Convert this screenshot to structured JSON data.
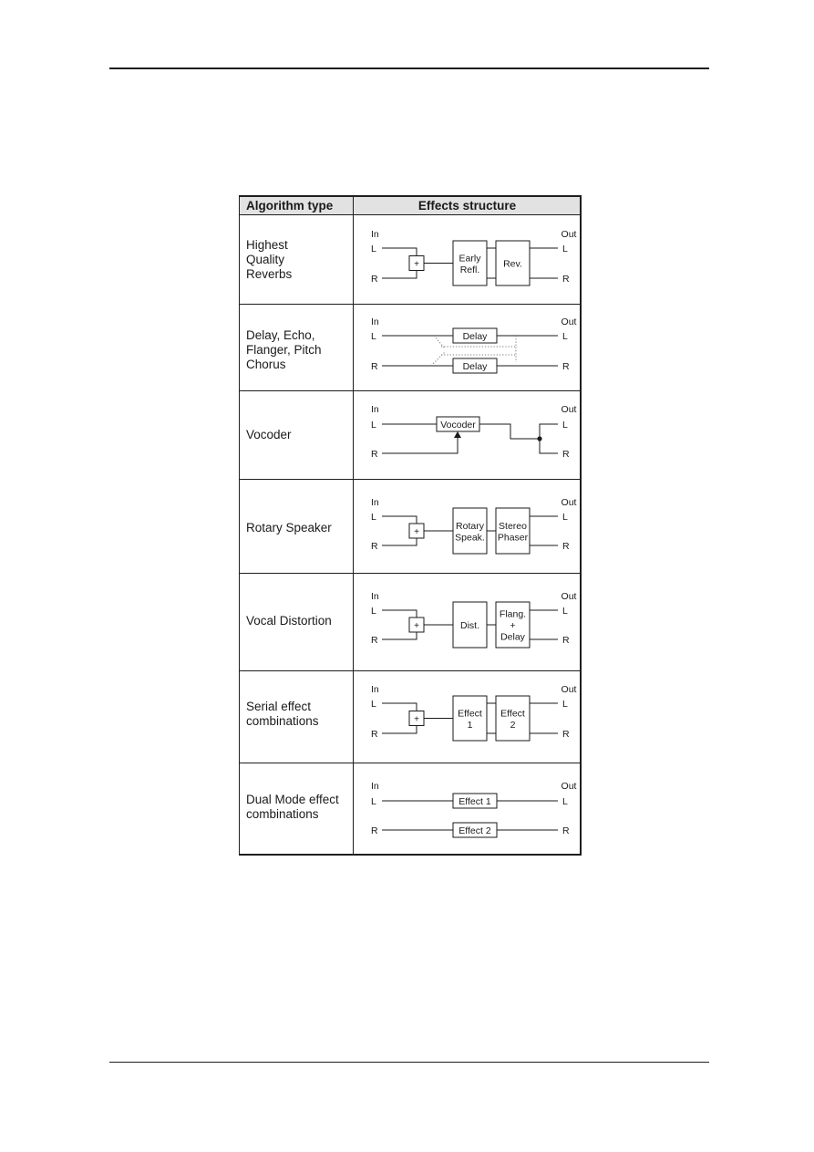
{
  "table": {
    "headers": {
      "algorithm_type": "Algorithm type",
      "effects_structure": "Effects structure"
    },
    "rows": [
      {
        "algorithm": "Highest\nQuality\nReverbs",
        "diagram": "reverb",
        "labels": {
          "in": "In",
          "out": "Out",
          "l": "L",
          "r": "R",
          "sum": "+",
          "block1": [
            "Early",
            "Refl."
          ],
          "block2": [
            "Rev."
          ]
        }
      },
      {
        "algorithm": "Delay, Echo,\nFlanger, Pitch\nChorus",
        "diagram": "delay",
        "labels": {
          "in": "In",
          "out": "Out",
          "l": "L",
          "r": "R",
          "block_l": "Delay",
          "block_r": "Delay"
        }
      },
      {
        "algorithm": "Vocoder",
        "diagram": "vocoder",
        "labels": {
          "in": "In",
          "out": "Out",
          "l": "L",
          "r": "R",
          "block": "Vocoder"
        }
      },
      {
        "algorithm": "Rotary Speaker",
        "diagram": "rotary",
        "labels": {
          "in": "In",
          "out": "Out",
          "l": "L",
          "r": "R",
          "sum": "+",
          "block1": [
            "Rotary",
            "Speak."
          ],
          "block2": [
            "Stereo",
            "Phaser"
          ]
        }
      },
      {
        "algorithm": "Vocal Distortion",
        "diagram": "distortion",
        "labels": {
          "in": "In",
          "out": "Out",
          "l": "L",
          "r": "R",
          "sum": "+",
          "block1": [
            "Dist."
          ],
          "block2": [
            "Flang.",
            "+",
            "Delay"
          ]
        }
      },
      {
        "algorithm": "Serial effect\ncombinations",
        "diagram": "serial",
        "labels": {
          "in": "In",
          "out": "Out",
          "l": "L",
          "r": "R",
          "sum": "+",
          "block1": [
            "Effect",
            "1"
          ],
          "block2": [
            "Effect",
            "2"
          ]
        }
      },
      {
        "algorithm": "Dual Mode effect\ncombinations",
        "diagram": "dual",
        "labels": {
          "in": "In",
          "out": "Out",
          "l": "L",
          "r": "R",
          "block_l": "Effect 1",
          "block_r": "Effect 2"
        }
      }
    ]
  }
}
